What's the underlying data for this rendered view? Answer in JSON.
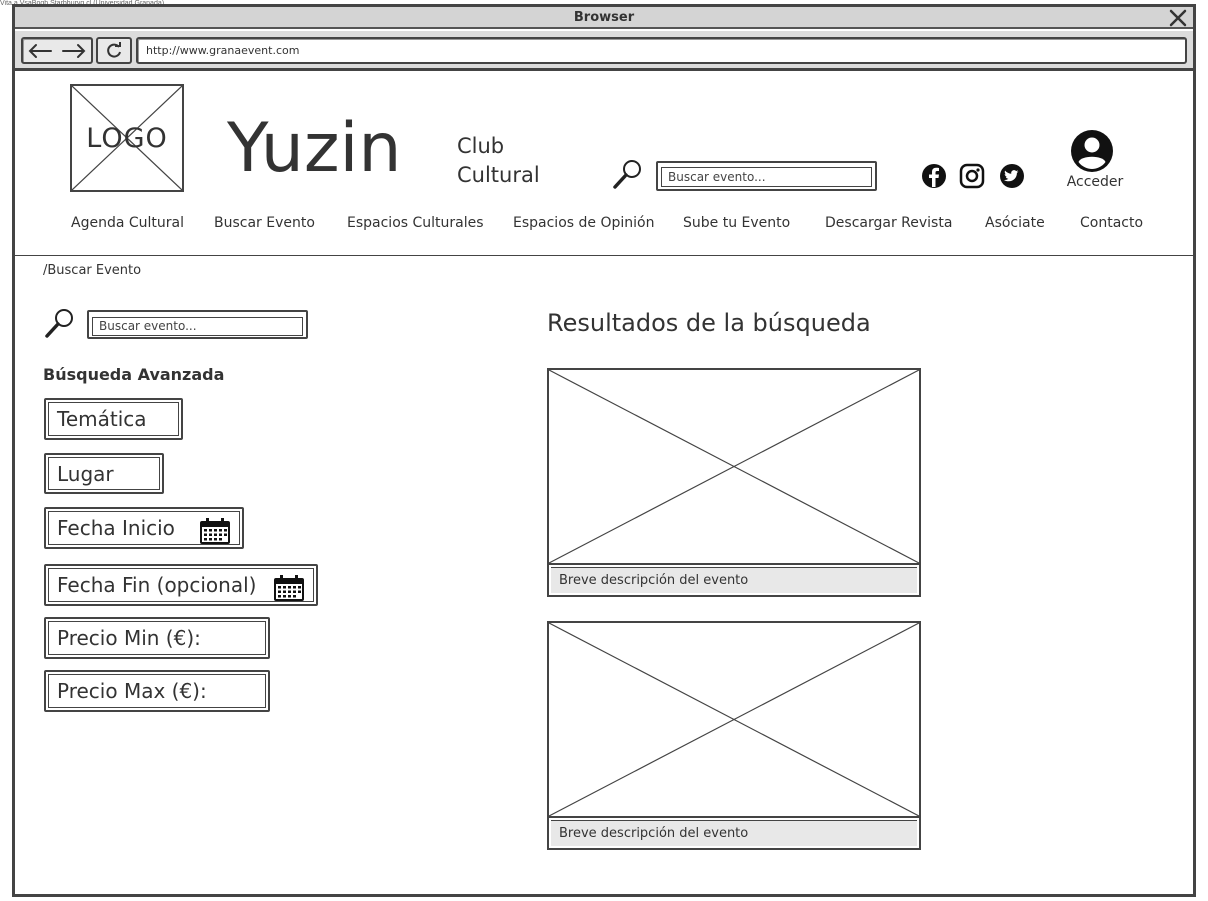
{
  "watermark": "Vita a VsaBogh Starbhuryg.cl (Universidad Granada)",
  "browser": {
    "title": "Browser",
    "url": "http://www.granaevent.com"
  },
  "header": {
    "logo_text": "LOGO",
    "brand": "Yuzin",
    "subtitle_line1": "Club",
    "subtitle_line2": "Cultural",
    "search_placeholder": "Buscar evento...",
    "social_icons": [
      "facebook-icon",
      "instagram-icon",
      "twitter-icon"
    ],
    "login_label": "Acceder"
  },
  "nav": {
    "items": [
      {
        "label": "Agenda Cultural"
      },
      {
        "label": "Buscar Evento"
      },
      {
        "label": "Espacios Culturales"
      },
      {
        "label": "Espacios de Opinión"
      },
      {
        "label": "Sube tu Evento"
      },
      {
        "label": "Descargar Revista"
      },
      {
        "label": "Asóciate"
      },
      {
        "label": "Contacto"
      }
    ]
  },
  "breadcrumb": "/Buscar Evento",
  "sidebar": {
    "search_placeholder": "Buscar evento...",
    "advanced_title": "Búsqueda Avanzada",
    "filters": {
      "topic": "Temática",
      "place": "Lugar",
      "start_date": "Fecha Inicio",
      "end_date": "Fecha Fin (opcional)",
      "price_min": "Precio Min (€):",
      "price_max": "Precio Max (€):"
    }
  },
  "results": {
    "title": "Resultados de la búsqueda",
    "cards": [
      {
        "description": "Breve descripción del evento"
      },
      {
        "description": "Breve descripción del evento"
      }
    ]
  }
}
